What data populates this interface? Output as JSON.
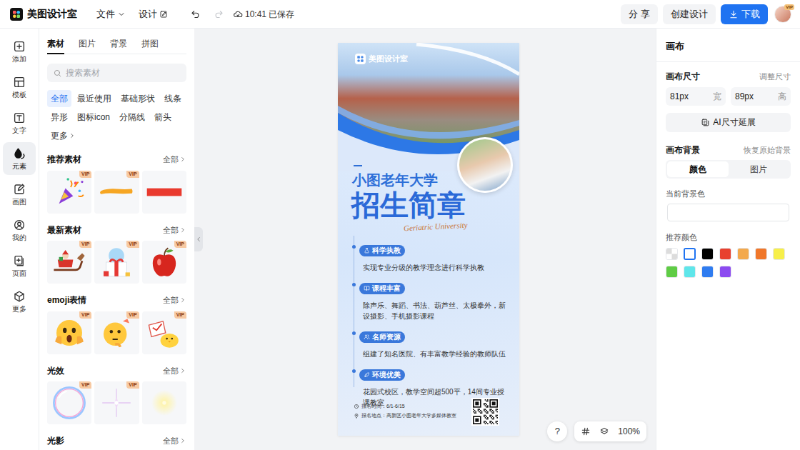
{
  "topbar": {
    "logo": "美图设计室",
    "menus": [
      {
        "label": "文件"
      },
      {
        "label": "设计"
      }
    ],
    "save_status": "10:41 已保存",
    "buttons": [
      {
        "label": "分 享",
        "kind": "secondary"
      },
      {
        "label": "创建设计",
        "kind": "secondary"
      },
      {
        "label": "下载",
        "kind": "primary"
      }
    ],
    "avatar_badge": "VIP"
  },
  "rail": [
    {
      "label": "添加",
      "selected": false
    },
    {
      "label": "模板",
      "selected": false
    },
    {
      "label": "文字",
      "selected": false
    },
    {
      "label": "元素",
      "selected": true
    },
    {
      "label": "画图",
      "selected": false
    },
    {
      "label": "我的",
      "selected": false
    },
    {
      "label": "页面",
      "selected": false
    },
    {
      "label": "更多",
      "selected": false
    }
  ],
  "panel": {
    "tabs": [
      {
        "label": "素材",
        "selected": true
      },
      {
        "label": "图片",
        "selected": false
      },
      {
        "label": "背景",
        "selected": false
      },
      {
        "label": "拼图",
        "selected": false
      }
    ],
    "search": {
      "placeholder": "搜索素材"
    },
    "chips": [
      {
        "label": "全部",
        "selected": true
      },
      {
        "label": "最近使用",
        "selected": false
      },
      {
        "label": "基础形状",
        "selected": false
      },
      {
        "label": "线条",
        "selected": false
      },
      {
        "label": "异形",
        "selected": false
      },
      {
        "label": "图标icon",
        "selected": false
      },
      {
        "label": "分隔线",
        "selected": false
      },
      {
        "label": "箭头",
        "selected": false
      },
      {
        "label": "更多",
        "selected": false
      }
    ],
    "sections": [
      {
        "title": "推荐素材",
        "more": "全部",
        "items": [
          {
            "kind": "confetti",
            "badge": "VIP"
          },
          {
            "kind": "stroke",
            "badge": "VIP"
          },
          {
            "kind": "bar"
          }
        ]
      },
      {
        "title": "最新素材",
        "more": "全部",
        "items": [
          {
            "kind": "sleigh",
            "badge": "VIP"
          },
          {
            "kind": "gift",
            "badge": "VIP"
          },
          {
            "kind": "apple",
            "badge": "VIP"
          }
        ]
      },
      {
        "title": "emoji表情",
        "more": "全部",
        "items": [
          {
            "kind": "shocked",
            "badge": "VIP"
          },
          {
            "kind": "thinking",
            "badge": "VIP"
          },
          {
            "kind": "chick",
            "badge": "VIP"
          }
        ]
      },
      {
        "title": "光效",
        "more": "全部",
        "items": [
          {
            "kind": "bubble",
            "badge": "VIP"
          },
          {
            "kind": "sparkle",
            "badge": "VIP"
          },
          {
            "kind": "glow"
          }
        ]
      },
      {
        "title": "光影",
        "more": "全部",
        "items": []
      }
    ]
  },
  "poster": {
    "brand": "美图设计室",
    "subtitle": "小图老年大学",
    "title": "招生简章",
    "script": "Geriatric University",
    "features": [
      {
        "label": "科学执教",
        "desc": "实现专业分级的教学理念进行科学执教"
      },
      {
        "label": "课程丰富",
        "desc": "除声乐、舞蹈、书法、葫芦丝、太极拳外，新设摄影、手机摄影课程"
      },
      {
        "label": "名师资源",
        "desc": "组建了知名医院、有丰富教学经验的教师队伍"
      },
      {
        "label": "环境优美",
        "desc": "花园式校区，教学空间超500平，14间专业授课教室"
      }
    ],
    "footer": [
      "报名时间：6/1-6/15",
      "报名地点：高新区小图老年大学多媒体教室"
    ]
  },
  "canvas_tools": {
    "help": "?",
    "zoom": "100%"
  },
  "inspector": {
    "title": "画布",
    "size_label": "画布尺寸",
    "size_action": "调整尺寸",
    "width": {
      "value": "81px",
      "unit": "宽"
    },
    "height": {
      "value": "89px",
      "unit": "高"
    },
    "ai_button": "AI尺寸延展",
    "bg_label": "画布背景",
    "bg_reset": "恢复原始背景",
    "bg_modes": [
      {
        "label": "颜色",
        "selected": true
      },
      {
        "label": "图片",
        "selected": false
      }
    ],
    "current_label": "当前背景色",
    "current_color": "#ffffff",
    "swatches_label": "推荐颜色",
    "swatches": [
      {
        "kind": "transparent",
        "selected": false
      },
      {
        "kind": "solid",
        "color": "#ffffff",
        "selected": true
      },
      {
        "kind": "solid",
        "color": "#000000",
        "selected": false
      },
      {
        "kind": "solid",
        "color": "#e8412f",
        "selected": false
      },
      {
        "kind": "solid",
        "color": "#f3a94d",
        "selected": false
      },
      {
        "kind": "solid",
        "color": "#f0772a",
        "selected": false
      },
      {
        "kind": "solid",
        "color": "#f7ef4a",
        "selected": false
      },
      {
        "kind": "solid",
        "color": "#5fcc45",
        "selected": false
      },
      {
        "kind": "solid",
        "color": "#5fe6ea",
        "selected": false
      },
      {
        "kind": "solid",
        "color": "#2f7cf0",
        "selected": false
      },
      {
        "kind": "solid",
        "color": "#8c4bf0",
        "selected": false
      }
    ]
  }
}
